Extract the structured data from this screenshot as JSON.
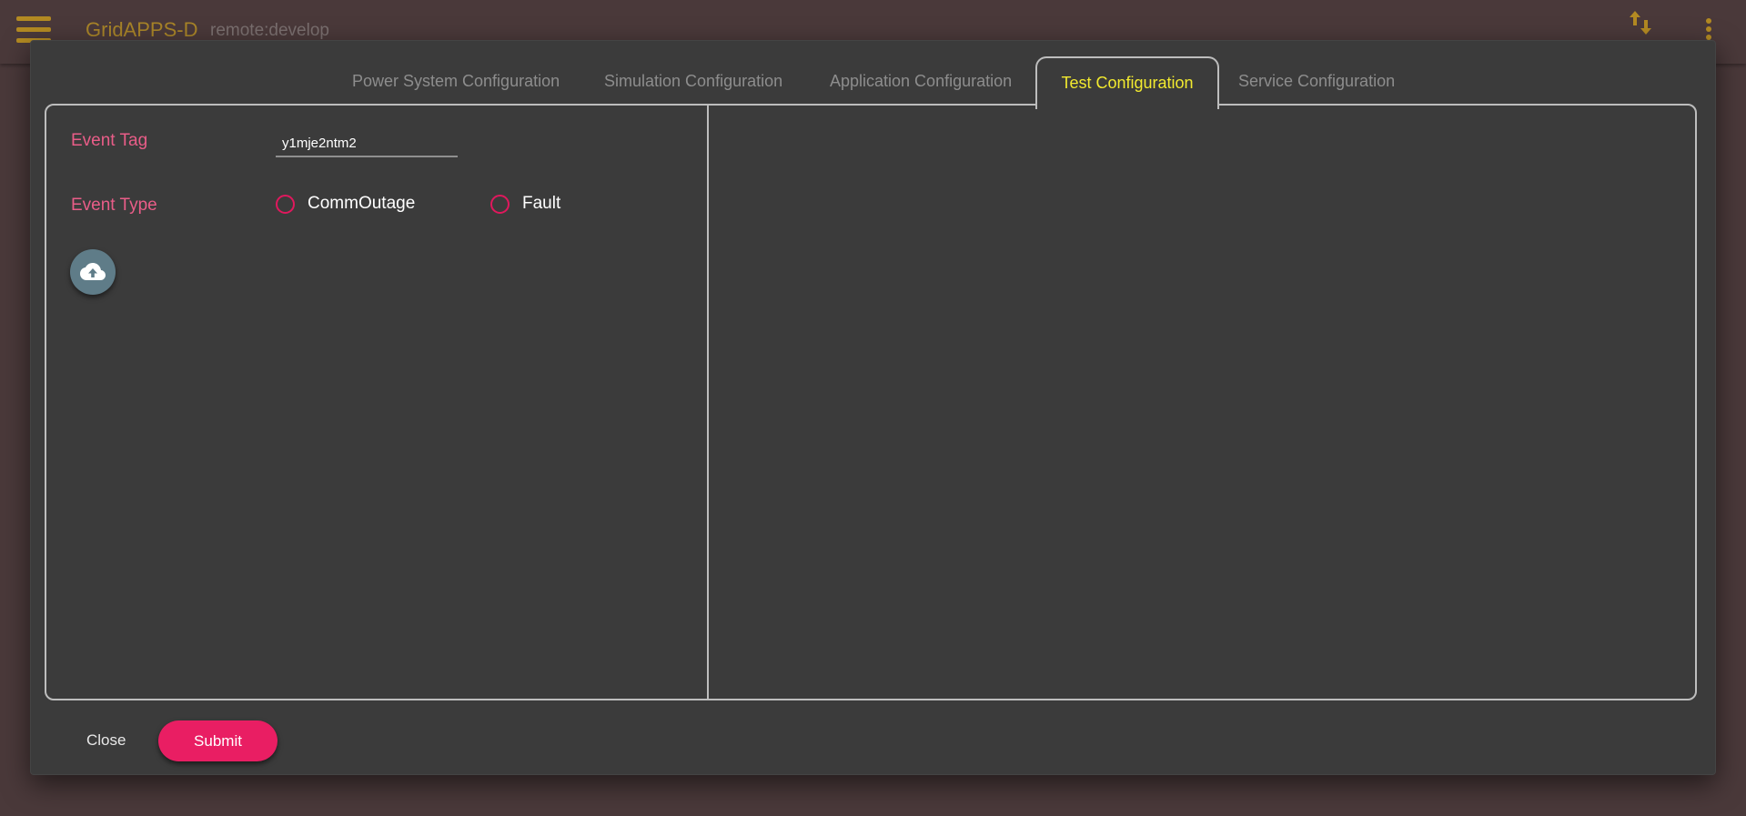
{
  "appbar": {
    "title": "GridAPPS-D",
    "subtitle": "remote:develop",
    "accent_color": "#b38a22"
  },
  "tabs": [
    {
      "label": "Power System Configuration",
      "active": false
    },
    {
      "label": "Simulation Configuration",
      "active": false
    },
    {
      "label": "Application Configuration",
      "active": false
    },
    {
      "label": "Test Configuration",
      "active": true
    },
    {
      "label": "Service Configuration",
      "active": false
    }
  ],
  "form": {
    "event_tag_label": "Event Tag",
    "event_tag_value": "y1mje2ntm2",
    "event_type_label": "Event Type",
    "event_type_options": [
      "CommOutage",
      "Fault"
    ],
    "upload_icon": "cloud-upload-icon"
  },
  "footer": {
    "close_label": "Close",
    "submit_label": "Submit"
  },
  "colors": {
    "label": "#e95d88",
    "active_tab": "#f2ea2f",
    "radio": "#e0185d",
    "submit": "#e91e63"
  }
}
